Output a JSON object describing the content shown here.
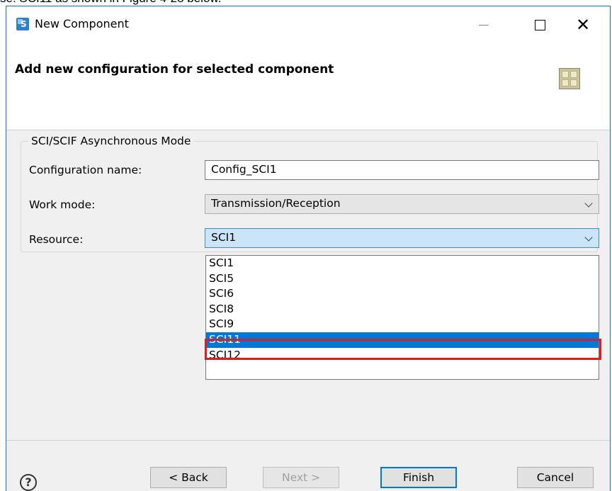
{
  "doc_text": "se: SCI11 as shown in Figure 4-28 below.",
  "window": {
    "title": "New Component",
    "minimize_symbol": "—",
    "maximize_symbol": "",
    "close_symbol": "✕"
  },
  "header": {
    "title": "Add new configuration for selected component",
    "icon": "component-grid-icon"
  },
  "group": {
    "legend": "SCI/SCIF Asynchronous Mode",
    "config_name_label": "Configuration name:",
    "config_name_value": "Config_SCI1",
    "work_mode_label": "Work mode:",
    "work_mode_value": "Transmission/Reception",
    "resource_label": "Resource:",
    "resource_value": "SCI1"
  },
  "dropdown": {
    "options": [
      "SCI1",
      "SCI5",
      "SCI6",
      "SCI8",
      "SCI9",
      "SCI11",
      "SCI12"
    ],
    "selected_index": 5
  },
  "footer": {
    "help_symbol": "?",
    "back_label": "< Back",
    "next_label": "Next >",
    "finish_label": "Finish",
    "cancel_label": "Cancel"
  },
  "colors": {
    "accent": "#0078d7",
    "highlight_box": "#e21b1b"
  }
}
